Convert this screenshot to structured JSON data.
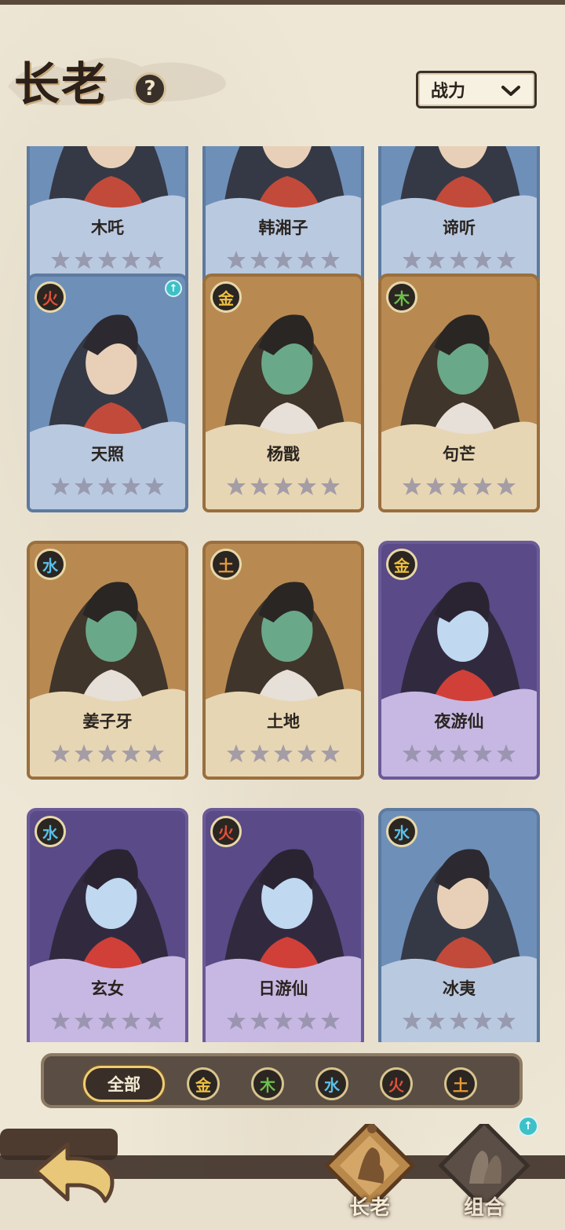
{
  "header": {
    "title": "长老",
    "help_glyph": "?",
    "sort_value": "战力"
  },
  "colors": {
    "fire": "#e0503a",
    "metal": "#f0c040",
    "wood": "#6cc04a",
    "water": "#58c0e8",
    "earth": "#e89a3a"
  },
  "cards": [
    {
      "name": "木吒",
      "frame": "blue",
      "element": "",
      "stars": 0
    },
    {
      "name": "韩湘子",
      "frame": "blue",
      "element": "",
      "stars": 0
    },
    {
      "name": "谛听",
      "frame": "blue",
      "element": "",
      "stars": 0
    },
    {
      "name": "天照",
      "frame": "blue",
      "element": "火",
      "element_key": "fire",
      "stars": 0,
      "upgrade": true
    },
    {
      "name": "杨戬",
      "frame": "gold",
      "element": "金",
      "element_key": "metal",
      "stars": 0
    },
    {
      "name": "句芒",
      "frame": "gold",
      "element": "木",
      "element_key": "wood",
      "stars": 0
    },
    {
      "name": "姜子牙",
      "frame": "gold",
      "element": "水",
      "element_key": "water",
      "stars": 0
    },
    {
      "name": "土地",
      "frame": "gold",
      "element": "土",
      "element_key": "earth",
      "stars": 0
    },
    {
      "name": "夜游仙",
      "frame": "purple",
      "element": "金",
      "element_key": "metal",
      "stars": 0
    },
    {
      "name": "玄女",
      "frame": "purple",
      "element": "水",
      "element_key": "water",
      "stars": 0
    },
    {
      "name": "日游仙",
      "frame": "purple",
      "element": "火",
      "element_key": "fire",
      "stars": 0
    },
    {
      "name": "冰夷",
      "frame": "blue",
      "element": "水",
      "element_key": "water",
      "stars": 0
    }
  ],
  "filters": {
    "all_label": "全部",
    "elements": [
      {
        "label": "金",
        "key": "metal"
      },
      {
        "label": "木",
        "key": "wood"
      },
      {
        "label": "水",
        "key": "water"
      },
      {
        "label": "火",
        "key": "fire"
      },
      {
        "label": "土",
        "key": "earth"
      }
    ]
  },
  "nav": {
    "elders_label": "长老",
    "combo_label": "组合"
  }
}
